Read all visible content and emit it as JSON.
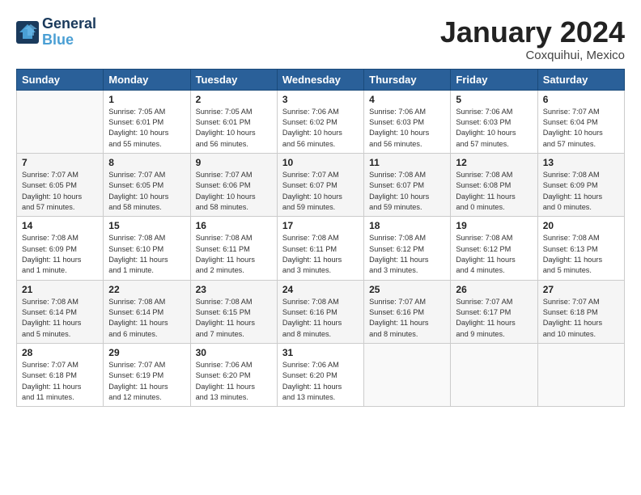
{
  "header": {
    "logo_line1": "General",
    "logo_line2": "Blue",
    "month_title": "January 2024",
    "location": "Coxquihui, Mexico"
  },
  "weekdays": [
    "Sunday",
    "Monday",
    "Tuesday",
    "Wednesday",
    "Thursday",
    "Friday",
    "Saturday"
  ],
  "weeks": [
    [
      {
        "num": "",
        "info": ""
      },
      {
        "num": "1",
        "info": "Sunrise: 7:05 AM\nSunset: 6:01 PM\nDaylight: 10 hours\nand 55 minutes."
      },
      {
        "num": "2",
        "info": "Sunrise: 7:05 AM\nSunset: 6:01 PM\nDaylight: 10 hours\nand 56 minutes."
      },
      {
        "num": "3",
        "info": "Sunrise: 7:06 AM\nSunset: 6:02 PM\nDaylight: 10 hours\nand 56 minutes."
      },
      {
        "num": "4",
        "info": "Sunrise: 7:06 AM\nSunset: 6:03 PM\nDaylight: 10 hours\nand 56 minutes."
      },
      {
        "num": "5",
        "info": "Sunrise: 7:06 AM\nSunset: 6:03 PM\nDaylight: 10 hours\nand 57 minutes."
      },
      {
        "num": "6",
        "info": "Sunrise: 7:07 AM\nSunset: 6:04 PM\nDaylight: 10 hours\nand 57 minutes."
      }
    ],
    [
      {
        "num": "7",
        "info": "Sunrise: 7:07 AM\nSunset: 6:05 PM\nDaylight: 10 hours\nand 57 minutes."
      },
      {
        "num": "8",
        "info": "Sunrise: 7:07 AM\nSunset: 6:05 PM\nDaylight: 10 hours\nand 58 minutes."
      },
      {
        "num": "9",
        "info": "Sunrise: 7:07 AM\nSunset: 6:06 PM\nDaylight: 10 hours\nand 58 minutes."
      },
      {
        "num": "10",
        "info": "Sunrise: 7:07 AM\nSunset: 6:07 PM\nDaylight: 10 hours\nand 59 minutes."
      },
      {
        "num": "11",
        "info": "Sunrise: 7:08 AM\nSunset: 6:07 PM\nDaylight: 10 hours\nand 59 minutes."
      },
      {
        "num": "12",
        "info": "Sunrise: 7:08 AM\nSunset: 6:08 PM\nDaylight: 11 hours\nand 0 minutes."
      },
      {
        "num": "13",
        "info": "Sunrise: 7:08 AM\nSunset: 6:09 PM\nDaylight: 11 hours\nand 0 minutes."
      }
    ],
    [
      {
        "num": "14",
        "info": "Sunrise: 7:08 AM\nSunset: 6:09 PM\nDaylight: 11 hours\nand 1 minute."
      },
      {
        "num": "15",
        "info": "Sunrise: 7:08 AM\nSunset: 6:10 PM\nDaylight: 11 hours\nand 1 minute."
      },
      {
        "num": "16",
        "info": "Sunrise: 7:08 AM\nSunset: 6:11 PM\nDaylight: 11 hours\nand 2 minutes."
      },
      {
        "num": "17",
        "info": "Sunrise: 7:08 AM\nSunset: 6:11 PM\nDaylight: 11 hours\nand 3 minutes."
      },
      {
        "num": "18",
        "info": "Sunrise: 7:08 AM\nSunset: 6:12 PM\nDaylight: 11 hours\nand 3 minutes."
      },
      {
        "num": "19",
        "info": "Sunrise: 7:08 AM\nSunset: 6:12 PM\nDaylight: 11 hours\nand 4 minutes."
      },
      {
        "num": "20",
        "info": "Sunrise: 7:08 AM\nSunset: 6:13 PM\nDaylight: 11 hours\nand 5 minutes."
      }
    ],
    [
      {
        "num": "21",
        "info": "Sunrise: 7:08 AM\nSunset: 6:14 PM\nDaylight: 11 hours\nand 5 minutes."
      },
      {
        "num": "22",
        "info": "Sunrise: 7:08 AM\nSunset: 6:14 PM\nDaylight: 11 hours\nand 6 minutes."
      },
      {
        "num": "23",
        "info": "Sunrise: 7:08 AM\nSunset: 6:15 PM\nDaylight: 11 hours\nand 7 minutes."
      },
      {
        "num": "24",
        "info": "Sunrise: 7:08 AM\nSunset: 6:16 PM\nDaylight: 11 hours\nand 8 minutes."
      },
      {
        "num": "25",
        "info": "Sunrise: 7:07 AM\nSunset: 6:16 PM\nDaylight: 11 hours\nand 8 minutes."
      },
      {
        "num": "26",
        "info": "Sunrise: 7:07 AM\nSunset: 6:17 PM\nDaylight: 11 hours\nand 9 minutes."
      },
      {
        "num": "27",
        "info": "Sunrise: 7:07 AM\nSunset: 6:18 PM\nDaylight: 11 hours\nand 10 minutes."
      }
    ],
    [
      {
        "num": "28",
        "info": "Sunrise: 7:07 AM\nSunset: 6:18 PM\nDaylight: 11 hours\nand 11 minutes."
      },
      {
        "num": "29",
        "info": "Sunrise: 7:07 AM\nSunset: 6:19 PM\nDaylight: 11 hours\nand 12 minutes."
      },
      {
        "num": "30",
        "info": "Sunrise: 7:06 AM\nSunset: 6:20 PM\nDaylight: 11 hours\nand 13 minutes."
      },
      {
        "num": "31",
        "info": "Sunrise: 7:06 AM\nSunset: 6:20 PM\nDaylight: 11 hours\nand 13 minutes."
      },
      {
        "num": "",
        "info": ""
      },
      {
        "num": "",
        "info": ""
      },
      {
        "num": "",
        "info": ""
      }
    ]
  ]
}
